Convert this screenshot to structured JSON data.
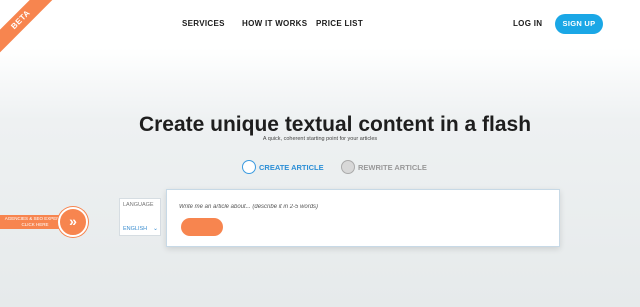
{
  "badge": {
    "label": "BETA"
  },
  "nav": {
    "services": "SERVICES",
    "how_it_works": "HOW IT WORKS",
    "price_list": "PRICE LIST",
    "login": "LOG IN",
    "signup": "SIGN UP"
  },
  "hero": {
    "title": "Create unique textual content in a flash",
    "subtitle": "A quick, coherent starting point for your articles"
  },
  "modes": {
    "create": "CREATE ARTICLE",
    "rewrite": "REWRITE ARTICLE"
  },
  "language": {
    "title": "LANGUAGE",
    "value": "ENGLISH"
  },
  "article": {
    "placeholder": "Write me an article about... (describe it in 2-5 words)"
  },
  "agency": {
    "line1": "AGENCIES & SEO EXPERTS",
    "line2": "CLICK HERE",
    "icon": "double-chevron-right-icon"
  },
  "colors": {
    "accent_orange": "#f7854f",
    "accent_blue": "#1aa7e6"
  }
}
